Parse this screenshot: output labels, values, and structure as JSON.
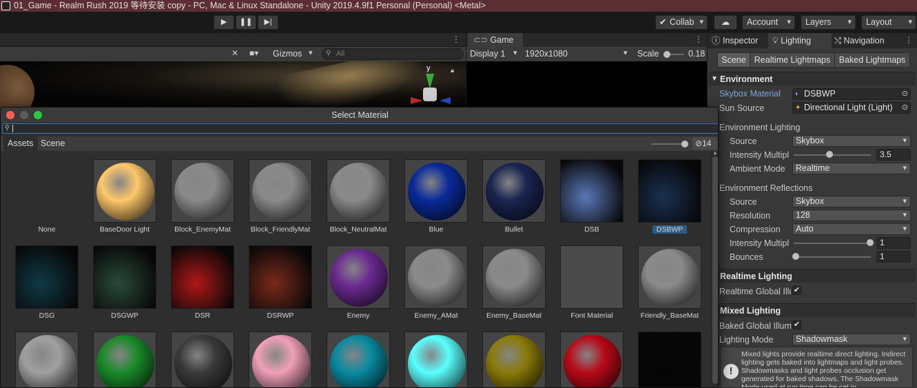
{
  "window": {
    "title": "01_Game - Realm Rush 2019 等待安装 copy - PC, Mac & Linux Standalone - Unity 2019.4.9f1 Personal (Personal) <Metal>"
  },
  "toolbar": {
    "play_icon": "play-icon",
    "pause_icon": "pause-icon",
    "step_icon": "step-icon",
    "collab": "Collab",
    "account": "Account",
    "layers": "Layers",
    "layout": "Layout"
  },
  "scene": {
    "gizmos": "Gizmos",
    "search_placeholder": "All",
    "axis_y": "y"
  },
  "game": {
    "tab": "Game",
    "display": "Display 1",
    "resolution": "1920x1080",
    "scale_label": "Scale",
    "scale_value": "0.18"
  },
  "right_panel": {
    "tabs": [
      "Inspector",
      "Lighting",
      "Navigation"
    ],
    "segments": [
      "Scene",
      "Realtime Lightmaps",
      "Baked Lightmaps"
    ],
    "environment": {
      "header": "Environment",
      "skybox_label": "Skybox Material",
      "skybox_value": "DSBWP",
      "sun_label": "Sun Source",
      "sun_value": "Directional Light (Light)"
    },
    "env_lighting": {
      "header": "Environment Lighting",
      "source_label": "Source",
      "source_value": "Skybox",
      "intensity_label": "Intensity Multipl",
      "intensity_value": "3.5",
      "intensity_fraction": 0.45,
      "ambient_label": "Ambient Mode",
      "ambient_value": "Realtime"
    },
    "env_reflections": {
      "header": "Environment Reflections",
      "source_label": "Source",
      "source_value": "Skybox",
      "resolution_label": "Resolution",
      "resolution_value": "128",
      "compression_label": "Compression",
      "compression_value": "Auto",
      "intensity_label": "Intensity Multipl",
      "intensity_value": "1",
      "intensity_fraction": 1.0,
      "bounces_label": "Bounces",
      "bounces_value": "1",
      "bounces_fraction": 0.0
    },
    "realtime_lighting": {
      "header": "Realtime Lighting",
      "gi_label": "Realtime Global Illu"
    },
    "mixed_lighting": {
      "header": "Mixed Lighting",
      "baked_label": "Baked Global Illum",
      "mode_label": "Lighting Mode",
      "mode_value": "Shadowmask",
      "help": "Mixed lights provide realtime direct lighting. Indirect lighting gets baked into lightmaps and light probes. Shadowmasks and light probes occlusion get generated for baked shadows. The Shadowmask Mode used at run time can be set in"
    }
  },
  "picker": {
    "title": "Select Material",
    "tabs": [
      "Assets",
      "Scene"
    ],
    "hidden_count": "14",
    "items": [
      {
        "label": "None",
        "kind": "none"
      },
      {
        "label": "BaseDoor Light",
        "kind": "sphere",
        "color": "#ffc86a"
      },
      {
        "label": "Block_EnemyMat",
        "kind": "sphere",
        "color": "#8a8a8a"
      },
      {
        "label": "Block_FriendlyMat",
        "kind": "sphere",
        "color": "#8a8a8a"
      },
      {
        "label": "Block_NeutralMat",
        "kind": "sphere",
        "color": "#8a8a8a"
      },
      {
        "label": "Blue",
        "kind": "sphere",
        "color": "#0a2a9a"
      },
      {
        "label": "Bullet",
        "kind": "sphere",
        "color": "#1a2550"
      },
      {
        "label": "DSB",
        "kind": "tex",
        "color": "#5a78b8"
      },
      {
        "label": "DSBWP",
        "kind": "tex",
        "color": "#1a3050",
        "selected": true
      },
      {
        "label": "DSG",
        "kind": "tex",
        "color": "#0f3a45"
      },
      {
        "label": "DSGWP",
        "kind": "tex",
        "color": "#2a4a3a"
      },
      {
        "label": "DSR",
        "kind": "tex",
        "color": "#b01818"
      },
      {
        "label": "DSRWP",
        "kind": "tex",
        "color": "#7a2a1a"
      },
      {
        "label": "Enemy",
        "kind": "sphere",
        "color": "#6a2a90"
      },
      {
        "label": "Enemy_AMat",
        "kind": "sphere",
        "color": "#8a8a8a"
      },
      {
        "label": "Enemy_BaseMat",
        "kind": "sphere",
        "color": "#8a8a8a"
      },
      {
        "label": "Font Material",
        "kind": "flat",
        "color": "#4a4a4a"
      },
      {
        "label": "Friendly_BaseMat",
        "kind": "sphere",
        "color": "#8a8a8a"
      },
      {
        "label": "",
        "kind": "sphere",
        "color": "#a0a0a0"
      },
      {
        "label": "",
        "kind": "sphere",
        "color": "#1a8a2a"
      },
      {
        "label": "",
        "kind": "sphere",
        "color": "#3a3a3a"
      },
      {
        "label": "",
        "kind": "sphere",
        "color": "#f0a0b8"
      },
      {
        "label": "",
        "kind": "sphere",
        "color": "#0a8aa0"
      },
      {
        "label": "",
        "kind": "sphere",
        "color": "#5affff"
      },
      {
        "label": "",
        "kind": "sphere",
        "color": "#8a7a0a"
      },
      {
        "label": "",
        "kind": "sphere",
        "color": "#b80a18"
      },
      {
        "label": "",
        "kind": "tex",
        "color": "#050505"
      }
    ]
  }
}
